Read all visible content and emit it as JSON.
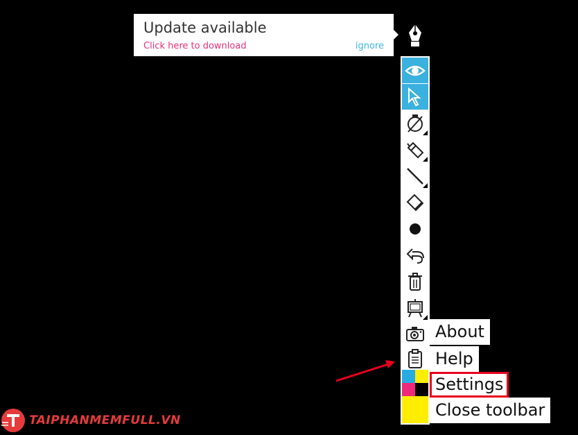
{
  "notification": {
    "title": "Update available",
    "link": "Click here to download",
    "ignore": "ignore"
  },
  "app_icon": "fountain-pen-icon",
  "toolbar": {
    "tools": [
      {
        "name": "eye-icon",
        "active": true
      },
      {
        "name": "cursor-icon",
        "active": true
      },
      {
        "name": "pen-off-icon",
        "active": false,
        "submenu": true
      },
      {
        "name": "highlighter-icon",
        "active": false,
        "submenu": true
      },
      {
        "name": "line-icon",
        "active": false,
        "submenu": true
      },
      {
        "name": "eraser-icon",
        "active": false
      },
      {
        "name": "dot-icon",
        "active": false
      },
      {
        "name": "undo-icon",
        "active": false
      },
      {
        "name": "trash-icon",
        "active": false
      },
      {
        "name": "easel-icon",
        "active": false,
        "submenu": true
      },
      {
        "name": "camera-icon",
        "active": false
      },
      {
        "name": "clipboard-icon",
        "active": false
      }
    ],
    "palette_colors": [
      "#29abe2",
      "#ffee00",
      "#ee2a7b",
      "#000000",
      "#ffee00",
      "#ffee00",
      "#ffee00",
      "#ffee00"
    ]
  },
  "menu": {
    "about": "About",
    "help": "Help",
    "settings": "Settings",
    "close": "Close toolbar"
  },
  "watermark": {
    "text": "TAIPHANMEMFULL.VN",
    "color": "#e53b3b"
  },
  "annotation_color": "#e8001c"
}
